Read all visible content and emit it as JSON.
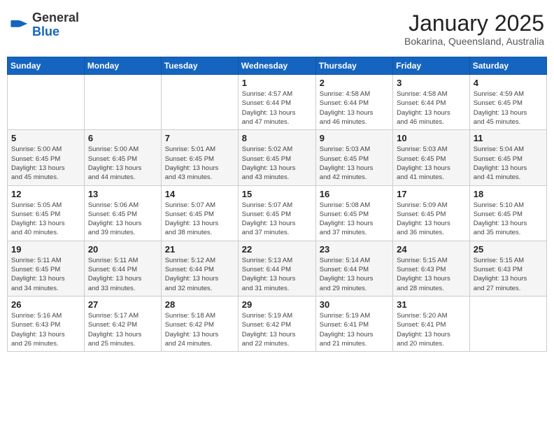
{
  "logo": {
    "general": "General",
    "blue": "Blue"
  },
  "header": {
    "month": "January 2025",
    "location": "Bokarina, Queensland, Australia"
  },
  "days_of_week": [
    "Sunday",
    "Monday",
    "Tuesday",
    "Wednesday",
    "Thursday",
    "Friday",
    "Saturday"
  ],
  "weeks": [
    [
      {
        "num": "",
        "info": ""
      },
      {
        "num": "",
        "info": ""
      },
      {
        "num": "",
        "info": ""
      },
      {
        "num": "1",
        "info": "Sunrise: 4:57 AM\nSunset: 6:44 PM\nDaylight: 13 hours\nand 47 minutes."
      },
      {
        "num": "2",
        "info": "Sunrise: 4:58 AM\nSunset: 6:44 PM\nDaylight: 13 hours\nand 46 minutes."
      },
      {
        "num": "3",
        "info": "Sunrise: 4:58 AM\nSunset: 6:44 PM\nDaylight: 13 hours\nand 46 minutes."
      },
      {
        "num": "4",
        "info": "Sunrise: 4:59 AM\nSunset: 6:45 PM\nDaylight: 13 hours\nand 45 minutes."
      }
    ],
    [
      {
        "num": "5",
        "info": "Sunrise: 5:00 AM\nSunset: 6:45 PM\nDaylight: 13 hours\nand 45 minutes."
      },
      {
        "num": "6",
        "info": "Sunrise: 5:00 AM\nSunset: 6:45 PM\nDaylight: 13 hours\nand 44 minutes."
      },
      {
        "num": "7",
        "info": "Sunrise: 5:01 AM\nSunset: 6:45 PM\nDaylight: 13 hours\nand 43 minutes."
      },
      {
        "num": "8",
        "info": "Sunrise: 5:02 AM\nSunset: 6:45 PM\nDaylight: 13 hours\nand 43 minutes."
      },
      {
        "num": "9",
        "info": "Sunrise: 5:03 AM\nSunset: 6:45 PM\nDaylight: 13 hours\nand 42 minutes."
      },
      {
        "num": "10",
        "info": "Sunrise: 5:03 AM\nSunset: 6:45 PM\nDaylight: 13 hours\nand 41 minutes."
      },
      {
        "num": "11",
        "info": "Sunrise: 5:04 AM\nSunset: 6:45 PM\nDaylight: 13 hours\nand 41 minutes."
      }
    ],
    [
      {
        "num": "12",
        "info": "Sunrise: 5:05 AM\nSunset: 6:45 PM\nDaylight: 13 hours\nand 40 minutes."
      },
      {
        "num": "13",
        "info": "Sunrise: 5:06 AM\nSunset: 6:45 PM\nDaylight: 13 hours\nand 39 minutes."
      },
      {
        "num": "14",
        "info": "Sunrise: 5:07 AM\nSunset: 6:45 PM\nDaylight: 13 hours\nand 38 minutes."
      },
      {
        "num": "15",
        "info": "Sunrise: 5:07 AM\nSunset: 6:45 PM\nDaylight: 13 hours\nand 37 minutes."
      },
      {
        "num": "16",
        "info": "Sunrise: 5:08 AM\nSunset: 6:45 PM\nDaylight: 13 hours\nand 37 minutes."
      },
      {
        "num": "17",
        "info": "Sunrise: 5:09 AM\nSunset: 6:45 PM\nDaylight: 13 hours\nand 36 minutes."
      },
      {
        "num": "18",
        "info": "Sunrise: 5:10 AM\nSunset: 6:45 PM\nDaylight: 13 hours\nand 35 minutes."
      }
    ],
    [
      {
        "num": "19",
        "info": "Sunrise: 5:11 AM\nSunset: 6:45 PM\nDaylight: 13 hours\nand 34 minutes."
      },
      {
        "num": "20",
        "info": "Sunrise: 5:11 AM\nSunset: 6:44 PM\nDaylight: 13 hours\nand 33 minutes."
      },
      {
        "num": "21",
        "info": "Sunrise: 5:12 AM\nSunset: 6:44 PM\nDaylight: 13 hours\nand 32 minutes."
      },
      {
        "num": "22",
        "info": "Sunrise: 5:13 AM\nSunset: 6:44 PM\nDaylight: 13 hours\nand 31 minutes."
      },
      {
        "num": "23",
        "info": "Sunrise: 5:14 AM\nSunset: 6:44 PM\nDaylight: 13 hours\nand 29 minutes."
      },
      {
        "num": "24",
        "info": "Sunrise: 5:15 AM\nSunset: 6:43 PM\nDaylight: 13 hours\nand 28 minutes."
      },
      {
        "num": "25",
        "info": "Sunrise: 5:15 AM\nSunset: 6:43 PM\nDaylight: 13 hours\nand 27 minutes."
      }
    ],
    [
      {
        "num": "26",
        "info": "Sunrise: 5:16 AM\nSunset: 6:43 PM\nDaylight: 13 hours\nand 26 minutes."
      },
      {
        "num": "27",
        "info": "Sunrise: 5:17 AM\nSunset: 6:42 PM\nDaylight: 13 hours\nand 25 minutes."
      },
      {
        "num": "28",
        "info": "Sunrise: 5:18 AM\nSunset: 6:42 PM\nDaylight: 13 hours\nand 24 minutes."
      },
      {
        "num": "29",
        "info": "Sunrise: 5:19 AM\nSunset: 6:42 PM\nDaylight: 13 hours\nand 22 minutes."
      },
      {
        "num": "30",
        "info": "Sunrise: 5:19 AM\nSunset: 6:41 PM\nDaylight: 13 hours\nand 21 minutes."
      },
      {
        "num": "31",
        "info": "Sunrise: 5:20 AM\nSunset: 6:41 PM\nDaylight: 13 hours\nand 20 minutes."
      },
      {
        "num": "",
        "info": ""
      }
    ]
  ]
}
